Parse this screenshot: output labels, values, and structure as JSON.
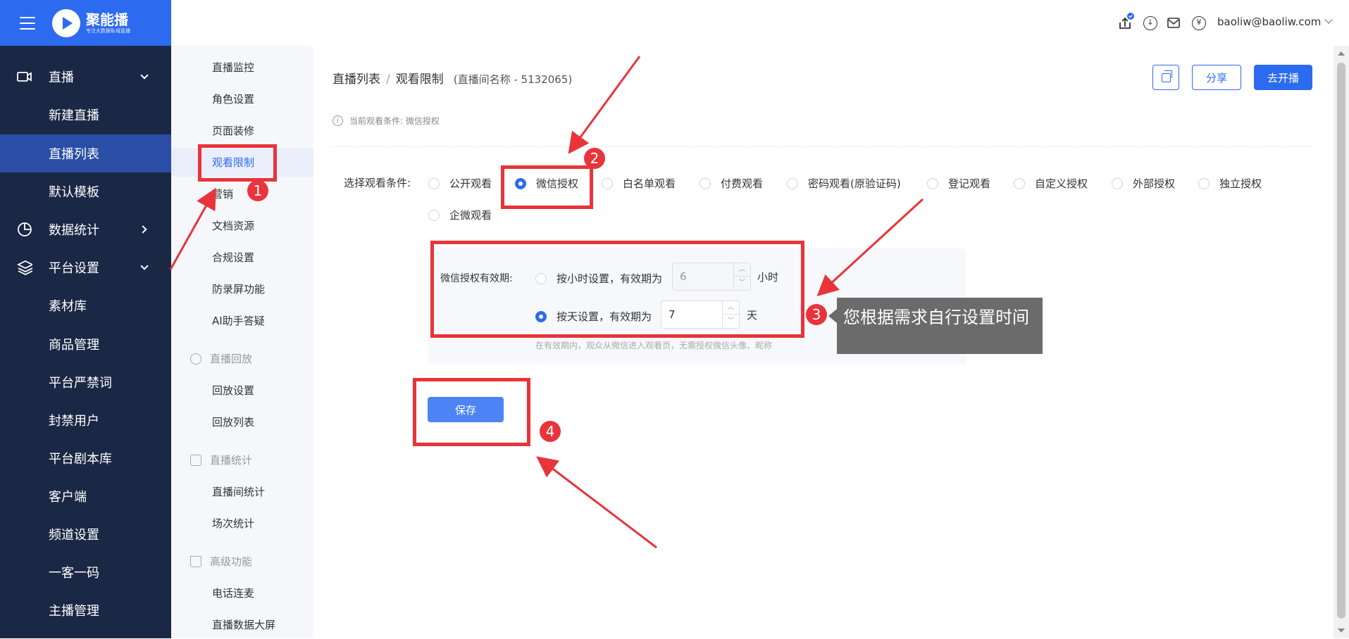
{
  "brand": {
    "name": "聚能播",
    "slogan": "专注大数据私域直播"
  },
  "header": {
    "user_email": "baoliw@baoliw.com"
  },
  "sidebar": {
    "items": [
      {
        "label": "直播",
        "icon": "video-icon",
        "type": "group",
        "expanded": true
      },
      {
        "label": "新建直播",
        "type": "sub"
      },
      {
        "label": "直播列表",
        "type": "sub",
        "active": true
      },
      {
        "label": "默认模板",
        "type": "sub"
      },
      {
        "label": "数据统计",
        "icon": "chart-pie-icon",
        "type": "group",
        "expanded": false
      },
      {
        "label": "平台设置",
        "icon": "layers-icon",
        "type": "group",
        "expanded": true
      },
      {
        "label": "素材库",
        "type": "sub"
      },
      {
        "label": "商品管理",
        "type": "sub"
      },
      {
        "label": "平台严禁词",
        "type": "sub"
      },
      {
        "label": "封禁用户",
        "type": "sub"
      },
      {
        "label": "平台剧本库",
        "type": "sub"
      },
      {
        "label": "客户端",
        "type": "sub"
      },
      {
        "label": "频道设置",
        "type": "sub"
      },
      {
        "label": "一客一码",
        "type": "sub"
      },
      {
        "label": "主播管理",
        "type": "sub"
      }
    ]
  },
  "subnav": {
    "items": [
      {
        "label": "直播监控",
        "type": "item"
      },
      {
        "label": "角色设置",
        "type": "item"
      },
      {
        "label": "页面装修",
        "type": "item"
      },
      {
        "label": "观看限制",
        "type": "item",
        "active": true
      },
      {
        "label": "营销",
        "type": "item"
      },
      {
        "label": "文档资源",
        "type": "item"
      },
      {
        "label": "合规设置",
        "type": "item"
      },
      {
        "label": "防录屏功能",
        "type": "item"
      },
      {
        "label": "AI助手答疑",
        "type": "item"
      },
      {
        "label": "直播回放",
        "type": "group"
      },
      {
        "label": "回放设置",
        "type": "item"
      },
      {
        "label": "回放列表",
        "type": "item"
      },
      {
        "label": "直播统计",
        "type": "group"
      },
      {
        "label": "直播间统计",
        "type": "item"
      },
      {
        "label": "场次统计",
        "type": "item"
      },
      {
        "label": "高级功能",
        "type": "group"
      },
      {
        "label": "电话连麦",
        "type": "item"
      },
      {
        "label": "直播数据大屏",
        "type": "item"
      }
    ]
  },
  "breadcrumb": {
    "parent": "直播列表",
    "sep": "/",
    "current": "观看限制",
    "room": "(直播间名称 - 5132065)"
  },
  "actions": {
    "share": "分享",
    "go_live": "去开播"
  },
  "notice": "当前观看条件: 微信授权",
  "conditions": {
    "label": "选择观看条件:",
    "options": [
      {
        "label": "公开观看",
        "checked": false
      },
      {
        "label": "微信授权",
        "checked": true
      },
      {
        "label": "白名单观看",
        "checked": false
      },
      {
        "label": "付费观看",
        "checked": false
      },
      {
        "label": "密码观看(原验证码)",
        "checked": false
      },
      {
        "label": "登记观看",
        "checked": false
      },
      {
        "label": "自定义授权",
        "checked": false
      },
      {
        "label": "外部授权",
        "checked": false
      },
      {
        "label": "独立授权",
        "checked": false
      },
      {
        "label": "企微观看",
        "checked": false
      }
    ]
  },
  "validity": {
    "label": "微信授权有效期:",
    "by_hour": {
      "label": "按小时设置，有效期为",
      "value": "6",
      "unit": "小时",
      "checked": false
    },
    "by_day": {
      "label": "按天设置，有效期为",
      "value": "7",
      "unit": "天",
      "checked": true
    },
    "hint": "在有效期内，观众从微信进入观看页，无需授权微信头像、昵称"
  },
  "save_label": "保存",
  "annotations": {
    "badges": [
      "1",
      "2",
      "3",
      "4"
    ],
    "tooltip": "您根据需求自行设置时间",
    "color": "#e8343a"
  },
  "colors": {
    "primary": "#2c6bef",
    "sidebar_bg": "#1b2845",
    "sidebar_active": "#2a4ea5"
  }
}
